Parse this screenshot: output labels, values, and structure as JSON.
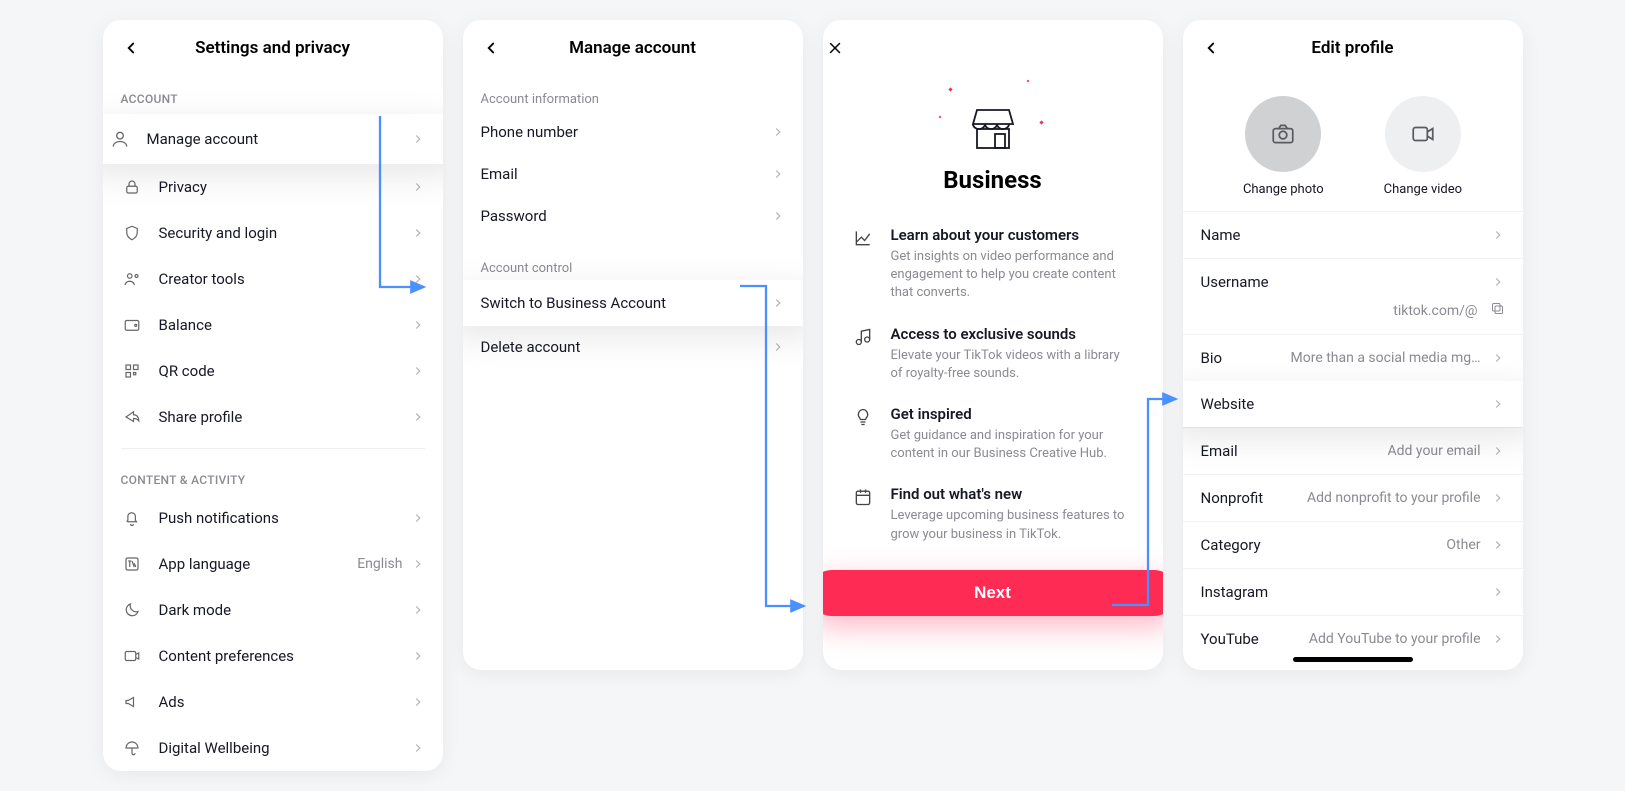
{
  "screen1": {
    "title": "Settings and privacy",
    "section_account": "ACCOUNT",
    "section_content": "CONTENT & ACTIVITY",
    "items_account": [
      {
        "label": "Manage account"
      },
      {
        "label": "Privacy"
      },
      {
        "label": "Security and login"
      },
      {
        "label": "Creator tools"
      },
      {
        "label": "Balance"
      },
      {
        "label": "QR code"
      },
      {
        "label": "Share profile"
      }
    ],
    "items_content": [
      {
        "label": "Push notifications"
      },
      {
        "label": "App language",
        "value": "English"
      },
      {
        "label": "Dark mode"
      },
      {
        "label": "Content preferences"
      },
      {
        "label": "Ads"
      },
      {
        "label": "Digital Wellbeing"
      }
    ]
  },
  "screen2": {
    "title": "Manage account",
    "section_info": "Account information",
    "section_control": "Account control",
    "items_info": [
      {
        "label": "Phone number"
      },
      {
        "label": "Email"
      },
      {
        "label": "Password"
      }
    ],
    "items_control": [
      {
        "label": "Switch to Business Account"
      },
      {
        "label": "Delete account"
      }
    ]
  },
  "screen3": {
    "title": "Business",
    "features": [
      {
        "head": "Learn about your customers",
        "desc": "Get insights on video performance and engagement to help you create content that converts."
      },
      {
        "head": "Access to exclusive sounds",
        "desc": "Elevate your TikTok videos with a library of royalty-free sounds."
      },
      {
        "head": "Get inspired",
        "desc": "Get guidance and inspiration for your content in our Business Creative Hub."
      },
      {
        "head": "Find out what's new",
        "desc": "Leverage upcoming business features to grow your business in TikTok."
      }
    ],
    "next": "Next"
  },
  "screen4": {
    "title": "Edit profile",
    "change_photo": "Change photo",
    "change_video": "Change video",
    "rows": {
      "name": {
        "label": "Name",
        "value": ""
      },
      "username": {
        "label": "Username",
        "value": ""
      },
      "url": {
        "value": "tiktok.com/@"
      },
      "bio": {
        "label": "Bio",
        "value": "More than a social media mgmt softwa..."
      },
      "website": {
        "label": "Website",
        "value": ""
      },
      "email": {
        "label": "Email",
        "value": "Add your email"
      },
      "nonprofit": {
        "label": "Nonprofit",
        "value": "Add nonprofit to your profile"
      },
      "category": {
        "label": "Category",
        "value": "Other"
      },
      "instagram": {
        "label": "Instagram",
        "value": ""
      },
      "youtube": {
        "label": "YouTube",
        "value": "Add YouTube to your profile"
      }
    }
  }
}
